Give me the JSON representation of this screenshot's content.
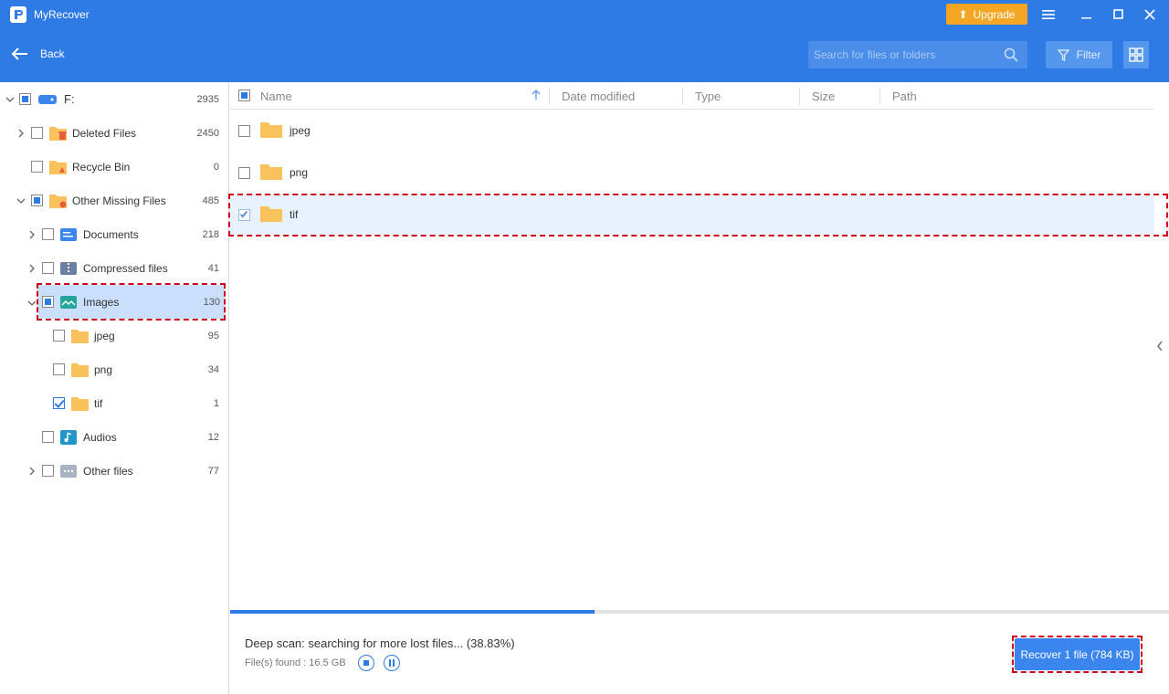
{
  "app": {
    "title": "MyRecover",
    "upgrade_label": "Upgrade"
  },
  "nav": {
    "back_label": "Back",
    "search_placeholder": "Search for files or folders",
    "filter_label": "Filter"
  },
  "tree": {
    "root": {
      "label": "F:",
      "count": "2935"
    },
    "deleted": {
      "label": "Deleted Files",
      "count": "2450"
    },
    "recycle": {
      "label": "Recycle Bin",
      "count": "0"
    },
    "other_missing": {
      "label": "Other Missing Files",
      "count": "485"
    },
    "documents": {
      "label": "Documents",
      "count": "218"
    },
    "compressed": {
      "label": "Compressed files",
      "count": "41"
    },
    "images": {
      "label": "Images",
      "count": "130"
    },
    "jpeg": {
      "label": "jpeg",
      "count": "95"
    },
    "png": {
      "label": "png",
      "count": "34"
    },
    "tif": {
      "label": "tif",
      "count": "1"
    },
    "audios": {
      "label": "Audios",
      "count": "12"
    },
    "other_files": {
      "label": "Other files",
      "count": "77"
    }
  },
  "columns": {
    "name": "Name",
    "date": "Date modified",
    "type": "Type",
    "size": "Size",
    "path": "Path"
  },
  "files": [
    {
      "name": "jpeg"
    },
    {
      "name": "png"
    },
    {
      "name": "tif"
    }
  ],
  "scan": {
    "status": "Deep scan: searching for more lost files... (38.83%)",
    "progress_percent": 38.83,
    "found": "File(s) found : 16.5 GB"
  },
  "recover_label": "Recover 1 file (784 KB)",
  "colors": {
    "accent": "#2e7be6",
    "upgrade": "#f5a623",
    "highlight": "#d0021b",
    "folder": "#f9c25c"
  }
}
